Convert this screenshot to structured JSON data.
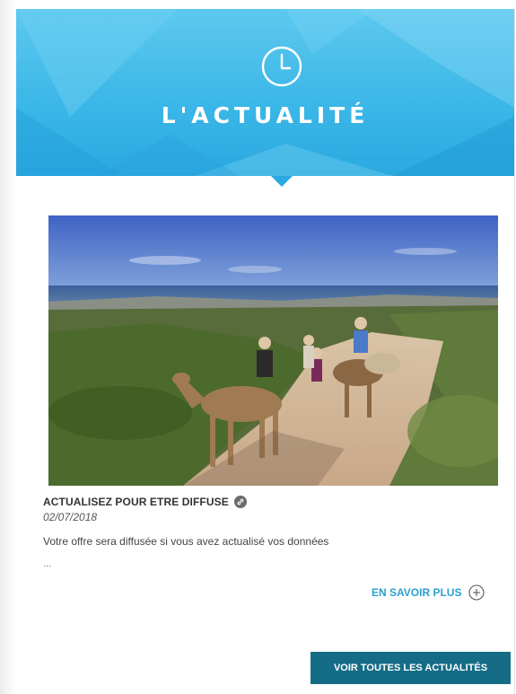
{
  "banner": {
    "title": "L'ACTUALITÉ",
    "icon": "clock-icon",
    "color": "#3cb7e8"
  },
  "article": {
    "title": "ACTUALISEZ POUR ETRE DIFFUSE",
    "title_icon": "link-icon",
    "date": "02/07/2018",
    "excerpt": "Votre offre sera diffusée si vous avez actualisé vos données",
    "ellipsis": "...",
    "image_icon": "camel-ride-photo"
  },
  "more_link": {
    "label": "EN SAVOIR PLUS",
    "icon": "plus-circle-icon",
    "color": "#2a9fd0"
  },
  "all_news_button": {
    "label": "VOIR TOUTES LES ACTUALITÉS",
    "color": "#156c86"
  }
}
